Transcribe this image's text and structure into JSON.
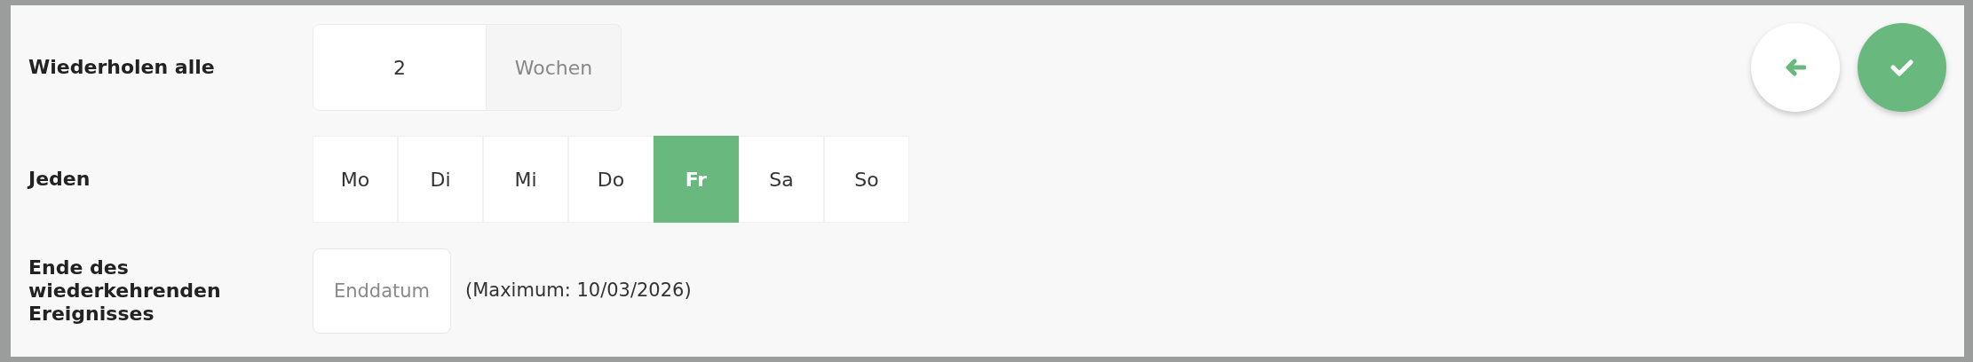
{
  "fields": [
    {
      "kind": "interval",
      "label": "Wiederholen alle",
      "value": "2",
      "unit": "Wochen"
    },
    {
      "kind": "days",
      "label": "Jeden",
      "days": [
        {
          "label": "Mo",
          "selected": false
        },
        {
          "label": "Di",
          "selected": false
        },
        {
          "label": "Mi",
          "selected": false
        },
        {
          "label": "Do",
          "selected": false
        },
        {
          "label": "Fr",
          "selected": true
        },
        {
          "label": "Sa",
          "selected": false
        },
        {
          "label": "So",
          "selected": false
        }
      ]
    },
    {
      "kind": "date",
      "label": "Ende des wiederkehrenden Ereignisses",
      "placeholder": "Enddatum",
      "hint": "(Maximum: 10/03/2026)"
    }
  ]
}
